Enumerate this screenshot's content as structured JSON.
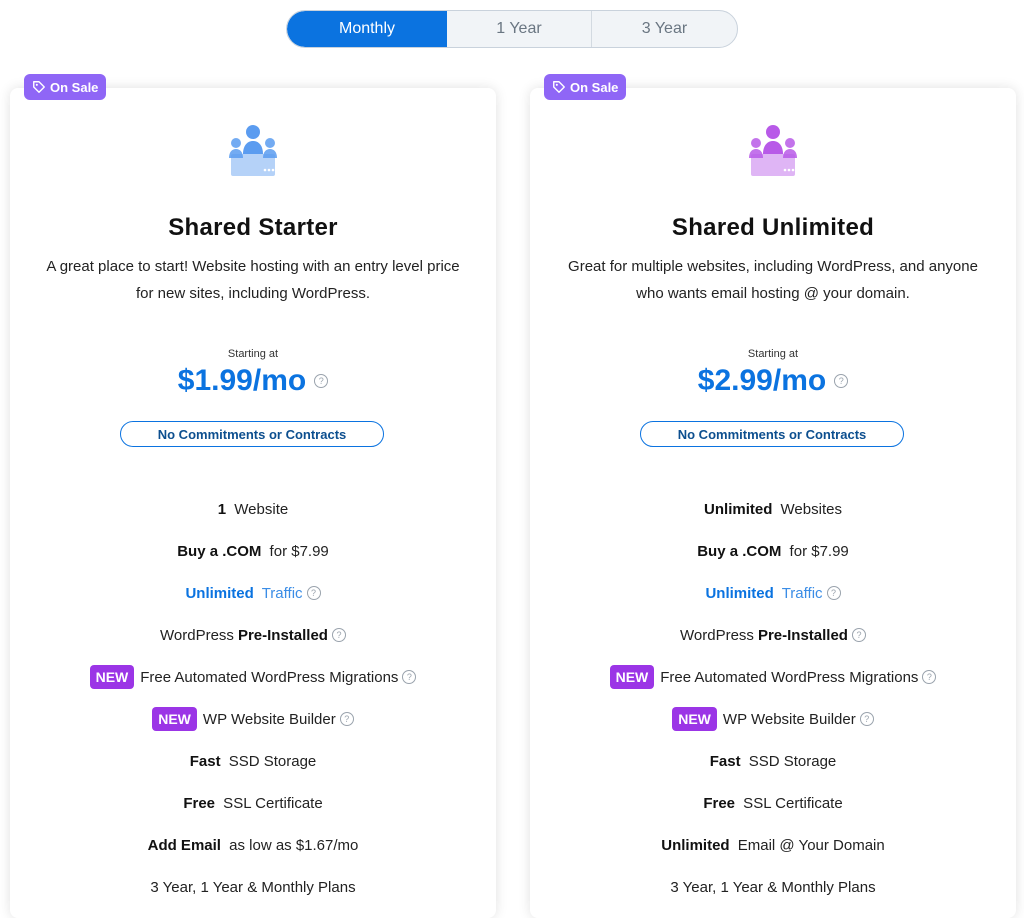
{
  "toggle": {
    "options": [
      "Monthly",
      "1 Year",
      "3 Year"
    ],
    "active": "Monthly",
    "accent": "#0b73e0"
  },
  "plans": [
    {
      "badge": "On Sale",
      "icon": "team-server-icon",
      "icon_color": "#5b9cf0",
      "title": "Shared Starter",
      "description": "A great place to start! Website hosting with an entry level price for new sites, including WordPress.",
      "starting_label": "Starting at",
      "price": "$1.99/mo",
      "commitment": "No Commitments or Contracts",
      "features": [
        {
          "bold": "1",
          "text": " Website"
        },
        {
          "bold": "Buy a .COM",
          "text": " for $7.99"
        },
        {
          "bold": "Unlimited",
          "text": " Traffic",
          "help": true,
          "blue": true
        },
        {
          "pre": "WordPress ",
          "bold": "Pre-Installed",
          "help": true
        },
        {
          "new": "NEW",
          "text": "Free Automated WordPress Migrations",
          "help": true
        },
        {
          "new": "NEW",
          "text": "WP Website Builder",
          "help": true
        },
        {
          "bold": "Fast",
          "text": " SSD Storage"
        },
        {
          "bold": "Free",
          "text": " SSL Certificate"
        },
        {
          "bold": "Add Email",
          "text": " as low as $1.67/mo"
        },
        {
          "text": "3 Year, 1 Year & Monthly Plans"
        }
      ]
    },
    {
      "badge": "On Sale",
      "icon": "team-server-icon",
      "icon_color": "#b85ae8",
      "title": "Shared Unlimited",
      "description": "Great for multiple websites, including WordPress, and anyone who wants email hosting @ your domain.",
      "starting_label": "Starting at",
      "price": "$2.99/mo",
      "commitment": "No Commitments or Contracts",
      "features": [
        {
          "bold": "Unlimited",
          "text": " Websites"
        },
        {
          "bold": "Buy a .COM",
          "text": " for $7.99"
        },
        {
          "bold": "Unlimited",
          "text": " Traffic",
          "help": true,
          "blue": true
        },
        {
          "pre": "WordPress ",
          "bold": "Pre-Installed",
          "help": true
        },
        {
          "new": "NEW",
          "text": "Free Automated WordPress Migrations",
          "help": true
        },
        {
          "new": "NEW",
          "text": "WP Website Builder",
          "help": true
        },
        {
          "bold": "Fast",
          "text": " SSD Storage"
        },
        {
          "bold": "Free",
          "text": " SSL Certificate"
        },
        {
          "bold": "Unlimited",
          "text": " Email @ Your Domain"
        },
        {
          "text": "3 Year, 1 Year & Monthly Plans"
        }
      ]
    }
  ],
  "help_glyph": "?"
}
